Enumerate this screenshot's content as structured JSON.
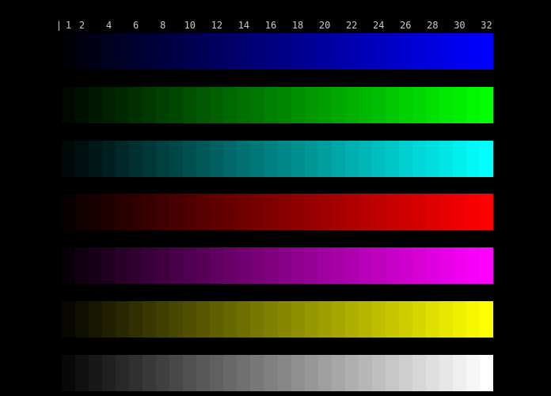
{
  "page": {
    "background": "#000000"
  },
  "scale": {
    "origin_mark": "|",
    "text_color": "#c9c9c9"
  },
  "chart_data": {
    "type": "heatmap",
    "title": "",
    "xlabel": "",
    "ylabel": "",
    "description": "32-step color intensity ramp test pattern: 7 stepped gradient bars from near-black to full intensity on black background",
    "steps": 32,
    "x_tick_labels": [
      "1",
      "2",
      "4",
      "6",
      "8",
      "10",
      "12",
      "14",
      "16",
      "18",
      "20",
      "22",
      "24",
      "26",
      "28",
      "30",
      "32"
    ],
    "x_tick_steps": [
      1,
      2,
      4,
      6,
      8,
      10,
      12,
      14,
      16,
      18,
      20,
      22,
      24,
      26,
      28,
      30,
      32
    ],
    "step_intensities": [
      8,
      16,
      24,
      32,
      40,
      48,
      56,
      64,
      72,
      80,
      88,
      96,
      104,
      112,
      120,
      128,
      135,
      143,
      151,
      159,
      167,
      175,
      183,
      191,
      199,
      207,
      215,
      223,
      231,
      239,
      247,
      255
    ],
    "rows": [
      {
        "name": "blue",
        "mask": [
          0,
          0,
          1
        ],
        "start_color": "#000008",
        "full_color": "#0000ff"
      },
      {
        "name": "green",
        "mask": [
          0,
          1,
          0
        ],
        "start_color": "#000800",
        "full_color": "#00ff00"
      },
      {
        "name": "cyan",
        "mask": [
          0,
          1,
          1
        ],
        "start_color": "#000808",
        "full_color": "#00ffff"
      },
      {
        "name": "red",
        "mask": [
          1,
          0,
          0
        ],
        "start_color": "#080000",
        "full_color": "#ff0000"
      },
      {
        "name": "magenta",
        "mask": [
          1,
          0,
          1
        ],
        "start_color": "#080008",
        "full_color": "#ff00ff"
      },
      {
        "name": "yellow",
        "mask": [
          1,
          1,
          0
        ],
        "start_color": "#080800",
        "full_color": "#ffff00"
      },
      {
        "name": "white",
        "mask": [
          1,
          1,
          1
        ],
        "start_color": "#080808",
        "full_color": "#ffffff"
      }
    ],
    "legend": null,
    "grid": false,
    "background": "#000000"
  }
}
